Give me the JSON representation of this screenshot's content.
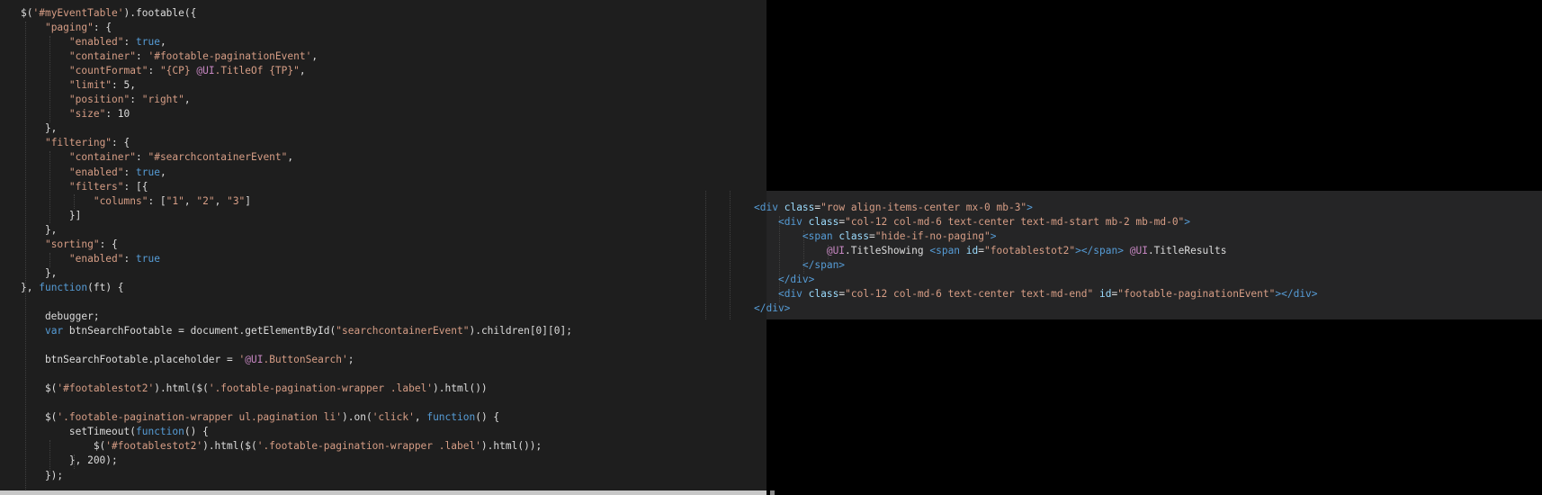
{
  "left_editor": {
    "lines": [
      [
        [
          "$(",
          ""
        ],
        [
          "'#myEventTable'",
          "str"
        ],
        [
          ").footable({",
          ""
        ]
      ],
      [
        [
          "    ",
          ""
        ],
        [
          "\"paging\"",
          "str"
        ],
        [
          ": {",
          ""
        ]
      ],
      [
        [
          "        ",
          ""
        ],
        [
          "\"enabled\"",
          "str"
        ],
        [
          ": ",
          ""
        ],
        [
          "true",
          "kw"
        ],
        [
          ",",
          ""
        ]
      ],
      [
        [
          "        ",
          ""
        ],
        [
          "\"container\"",
          "str"
        ],
        [
          ": ",
          ""
        ],
        [
          "'#footable-paginationEvent'",
          "str"
        ],
        [
          ",",
          ""
        ]
      ],
      [
        [
          "        ",
          ""
        ],
        [
          "\"countFormat\"",
          "str"
        ],
        [
          ": ",
          ""
        ],
        [
          "\"{CP} ",
          "str"
        ],
        [
          "@UI",
          "raz"
        ],
        [
          ".TitleOf {TP}\"",
          "str"
        ],
        [
          ",",
          ""
        ]
      ],
      [
        [
          "        ",
          ""
        ],
        [
          "\"limit\"",
          "str"
        ],
        [
          ": 5,",
          ""
        ]
      ],
      [
        [
          "        ",
          ""
        ],
        [
          "\"position\"",
          "str"
        ],
        [
          ": ",
          ""
        ],
        [
          "\"right\"",
          "str"
        ],
        [
          ",",
          ""
        ]
      ],
      [
        [
          "        ",
          ""
        ],
        [
          "\"size\"",
          "str"
        ],
        [
          ": 10",
          ""
        ]
      ],
      [
        [
          "    },",
          ""
        ]
      ],
      [
        [
          "    ",
          ""
        ],
        [
          "\"filtering\"",
          "str"
        ],
        [
          ": {",
          ""
        ]
      ],
      [
        [
          "        ",
          ""
        ],
        [
          "\"container\"",
          "str"
        ],
        [
          ": ",
          ""
        ],
        [
          "\"#searchcontainerEvent\"",
          "str"
        ],
        [
          ",",
          ""
        ]
      ],
      [
        [
          "        ",
          ""
        ],
        [
          "\"enabled\"",
          "str"
        ],
        [
          ": ",
          ""
        ],
        [
          "true",
          "kw"
        ],
        [
          ",",
          ""
        ]
      ],
      [
        [
          "        ",
          ""
        ],
        [
          "\"filters\"",
          "str"
        ],
        [
          ": [{",
          ""
        ]
      ],
      [
        [
          "            ",
          ""
        ],
        [
          "\"columns\"",
          "str"
        ],
        [
          ": [",
          ""
        ],
        [
          "\"1\"",
          "str"
        ],
        [
          ", ",
          ""
        ],
        [
          "\"2\"",
          "str"
        ],
        [
          ", ",
          ""
        ],
        [
          "\"3\"",
          "str"
        ],
        [
          "]",
          ""
        ]
      ],
      [
        [
          "        }]",
          ""
        ]
      ],
      [
        [
          "    },",
          ""
        ]
      ],
      [
        [
          "    ",
          ""
        ],
        [
          "\"sorting\"",
          "str"
        ],
        [
          ": {",
          ""
        ]
      ],
      [
        [
          "        ",
          ""
        ],
        [
          "\"enabled\"",
          "str"
        ],
        [
          ": ",
          ""
        ],
        [
          "true",
          "kw"
        ]
      ],
      [
        [
          "    },",
          ""
        ]
      ],
      [
        [
          "}, ",
          ""
        ],
        [
          "function",
          "kw"
        ],
        [
          "(ft) {",
          ""
        ]
      ],
      [],
      [
        [
          "    debugger;",
          ""
        ]
      ],
      [
        [
          "    ",
          ""
        ],
        [
          "var",
          "kw"
        ],
        [
          " btnSearchFootable = document.getElementById(",
          ""
        ],
        [
          "\"searchcontainerEvent\"",
          "str"
        ],
        [
          ").children[0][0];",
          ""
        ]
      ],
      [],
      [
        [
          "    btnSearchFootable.placeholder = ",
          ""
        ],
        [
          "'",
          "str"
        ],
        [
          "@UI",
          "raz"
        ],
        [
          ".ButtonSearch'",
          "str"
        ],
        [
          ";",
          ""
        ]
      ],
      [],
      [
        [
          "    $(",
          ""
        ],
        [
          "'#footablestot2'",
          "str"
        ],
        [
          ").html($(",
          ""
        ],
        [
          "'.footable-pagination-wrapper .label'",
          "str"
        ],
        [
          ").html())",
          ""
        ]
      ],
      [],
      [
        [
          "    $(",
          ""
        ],
        [
          "'.footable-pagination-wrapper ul.pagination li'",
          "str"
        ],
        [
          ").on(",
          ""
        ],
        [
          "'click'",
          "str"
        ],
        [
          ", ",
          ""
        ],
        [
          "function",
          "kw"
        ],
        [
          "() {",
          ""
        ]
      ],
      [
        [
          "        setTimeout(",
          ""
        ],
        [
          "function",
          "kw"
        ],
        [
          "() {",
          ""
        ]
      ],
      [
        [
          "            $(",
          ""
        ],
        [
          "'#footablestot2'",
          "str"
        ],
        [
          ").html($(",
          ""
        ],
        [
          "'.footable-pagination-wrapper .label'",
          "str"
        ],
        [
          ").html());",
          ""
        ]
      ],
      [
        [
          "        }, 200);",
          ""
        ]
      ],
      [
        [
          "    });",
          ""
        ]
      ]
    ]
  },
  "right_editor": {
    "lines": [
      [
        [
          "<",
          "tag"
        ],
        [
          "div",
          "tag"
        ],
        [
          " ",
          ""
        ],
        [
          "class",
          "attr"
        ],
        [
          "=",
          ""
        ],
        [
          "\"row align-items-center mx-0 mb-3\"",
          "str"
        ],
        [
          ">",
          "tag"
        ]
      ],
      [
        [
          "    ",
          ""
        ],
        [
          "<",
          "tag"
        ],
        [
          "div",
          "tag"
        ],
        [
          " ",
          ""
        ],
        [
          "class",
          "attr"
        ],
        [
          "=",
          ""
        ],
        [
          "\"col-12 col-md-6 text-center text-md-start mb-2 mb-md-0\"",
          "str"
        ],
        [
          ">",
          "tag"
        ]
      ],
      [
        [
          "        ",
          ""
        ],
        [
          "<",
          "tag"
        ],
        [
          "span",
          "tag"
        ],
        [
          " ",
          ""
        ],
        [
          "class",
          "attr"
        ],
        [
          "=",
          ""
        ],
        [
          "\"hide-if-no-paging\"",
          "str"
        ],
        [
          ">",
          "tag"
        ]
      ],
      [
        [
          "            ",
          ""
        ],
        [
          "@UI",
          "raz"
        ],
        [
          ".TitleShowing ",
          ""
        ],
        [
          "<",
          "tag"
        ],
        [
          "span",
          "tag"
        ],
        [
          " ",
          ""
        ],
        [
          "id",
          "attr"
        ],
        [
          "=",
          ""
        ],
        [
          "\"footablestot2\"",
          "str"
        ],
        [
          "></span>",
          "tag"
        ],
        [
          " ",
          ""
        ],
        [
          "@UI",
          "raz"
        ],
        [
          ".TitleResults",
          ""
        ]
      ],
      [
        [
          "        ",
          ""
        ],
        [
          "</span>",
          "tag"
        ]
      ],
      [
        [
          "    ",
          ""
        ],
        [
          "</div>",
          "tag"
        ]
      ],
      [
        [
          "    ",
          ""
        ],
        [
          "<",
          "tag"
        ],
        [
          "div",
          "tag"
        ],
        [
          " ",
          ""
        ],
        [
          "class",
          "attr"
        ],
        [
          "=",
          ""
        ],
        [
          "\"col-12 col-md-6 text-center text-md-end\"",
          "str"
        ],
        [
          " ",
          ""
        ],
        [
          "id",
          "attr"
        ],
        [
          "=",
          ""
        ],
        [
          "\"footable-paginationEvent\"",
          "str"
        ],
        [
          "></div>",
          "tag"
        ]
      ],
      [
        [
          "</div>",
          "tag"
        ]
      ]
    ]
  },
  "colors": {
    "editor_background": "#1e1e1e",
    "keyword": "#569cd6",
    "string": "#d69d85",
    "razor": "#c586c0",
    "attribute": "#9cdcfe",
    "text": "#dcdcdc"
  }
}
